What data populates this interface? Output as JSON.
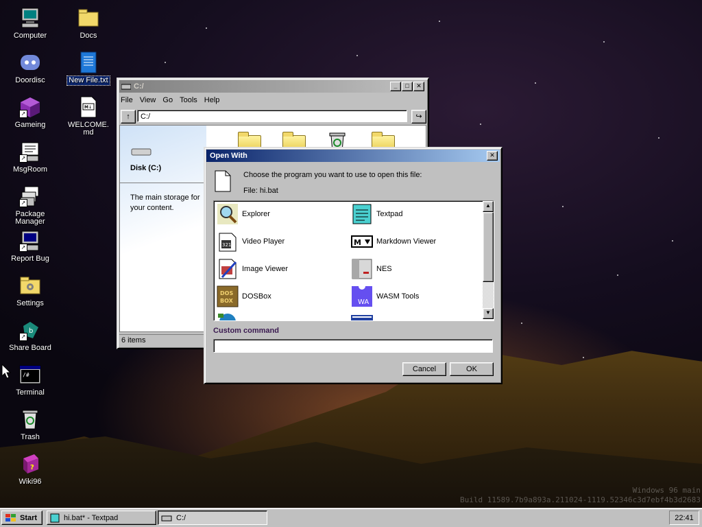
{
  "desktop": {
    "icons": [
      {
        "label": "Computer",
        "icon": "computer-icon"
      },
      {
        "label": "Docs",
        "icon": "folder-icon"
      },
      {
        "label": "Doordisc",
        "icon": "discord-icon"
      },
      {
        "label": "New File.txt",
        "icon": "text-file-icon"
      },
      {
        "label": "Gameing",
        "icon": "game-cube-icon"
      },
      {
        "label": "WELCOME.md",
        "icon": "markdown-file-icon"
      },
      {
        "label": "MsgRoom",
        "icon": "chat-icon"
      },
      {
        "label": "Package Manager",
        "icon": "package-icon"
      },
      {
        "label": "Report Bug",
        "icon": "bug-report-icon"
      },
      {
        "label": "Settings",
        "icon": "settings-folder-icon"
      },
      {
        "label": "Share Board",
        "icon": "share-board-icon"
      },
      {
        "label": "Terminal",
        "icon": "terminal-icon"
      },
      {
        "label": "Trash",
        "icon": "recycle-bin-icon"
      },
      {
        "label": "Wiki96",
        "icon": "book-icon"
      }
    ],
    "watermark_line1": "Windows 96 main",
    "watermark_line2": "Build 11589.7b9a893a.211024-1119.52346c3d7ebf4b3d2683"
  },
  "explorer": {
    "title": "C:/",
    "menu": [
      "File",
      "View",
      "Go",
      "Tools",
      "Help"
    ],
    "address": "C:/",
    "up_icon": "up-arrow-icon",
    "go_icon": "go-arrow-icon",
    "sidebar_title": "Disk (C:)",
    "sidebar_desc": "The main storage for your content.",
    "status": "6 items"
  },
  "open_with": {
    "title": "Open With",
    "prompt": "Choose the program you want to use to open this file:",
    "file_label": "File: hi.bat",
    "apps": [
      {
        "name": "Explorer",
        "icon": "magnifier-icon"
      },
      {
        "name": "Textpad",
        "icon": "notepad-icon"
      },
      {
        "name": "Video Player",
        "icon": "video-player-icon"
      },
      {
        "name": "Markdown Viewer",
        "icon": "markdown-icon"
      },
      {
        "name": "Image Viewer",
        "icon": "image-viewer-icon"
      },
      {
        "name": "NES",
        "icon": "nes-console-icon"
      },
      {
        "name": "DOSBox",
        "icon": "dosbox-icon"
      },
      {
        "name": "WASM Tools",
        "icon": "wasm-icon"
      }
    ],
    "custom_label": "Custom command",
    "custom_value": "",
    "cancel": "Cancel",
    "ok": "OK"
  },
  "taskbar": {
    "start": "Start",
    "tasks": [
      {
        "label": "hi.bat* - Textpad",
        "icon": "notepad-icon"
      },
      {
        "label": "C:/",
        "icon": "drive-icon"
      }
    ],
    "clock": "22:41"
  },
  "colors": {
    "title_active": "#0a246a",
    "window_face": "#c0c0c0",
    "sidebar_gradient_top": "#cfe2f7"
  }
}
